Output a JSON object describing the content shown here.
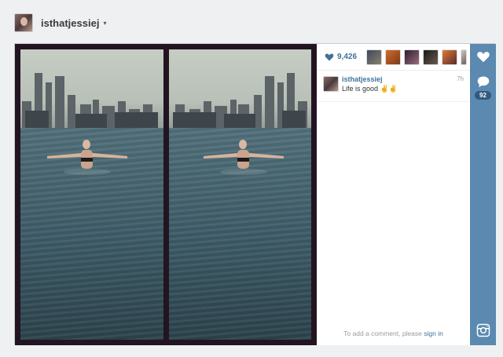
{
  "header": {
    "username": "isthatjessiej",
    "caret": "▾"
  },
  "post": {
    "likes_count": "9,426",
    "caption_user": "isthatjessiej",
    "caption_text": "Life is good ✌️✌️",
    "time": "7h",
    "comment_prompt": "To add a comment, please",
    "comment_link": "sign in",
    "comment_count": "92"
  },
  "colors": {
    "link_blue": "#3f729b",
    "rail_blue": "#5b89b0",
    "photo_border": "#221421"
  },
  "icons": {
    "like": "heart-icon",
    "comment": "speech-bubble-icon",
    "logo": "instagram-camera-icon"
  }
}
